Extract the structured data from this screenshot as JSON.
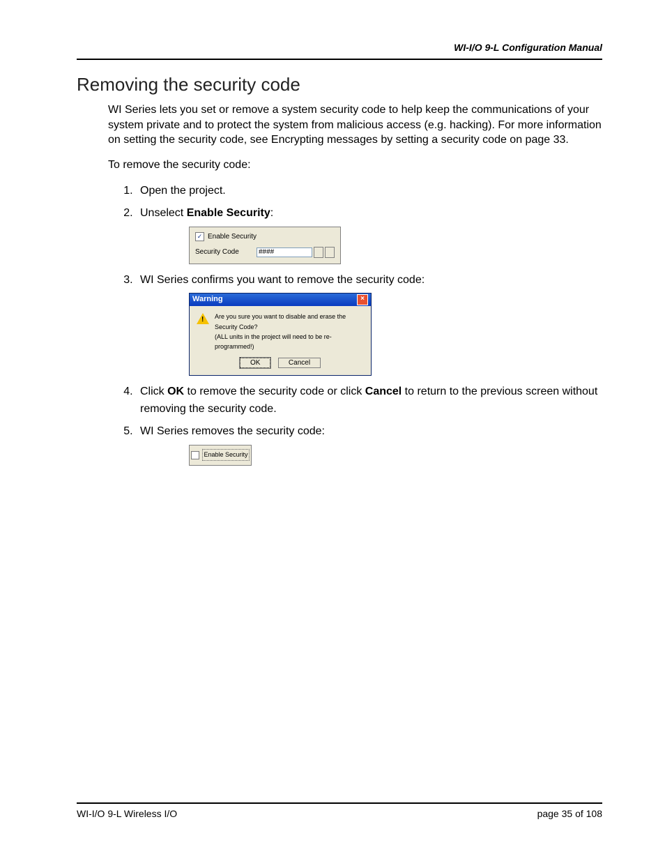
{
  "header": {
    "doc_title": "WI-I/O 9-L Configuration Manual"
  },
  "section": {
    "title": "Removing the security code",
    "intro": "WI Series lets you set or remove a system security code to help keep the communications of your system private and to protect the system from malicious access (e.g. hacking). For more information on setting the security code, see Encrypting messages by setting a security code on page 33.",
    "lead_in": "To remove the security code:"
  },
  "steps": {
    "s1": "Open the project.",
    "s2_pre": "Unselect ",
    "s2_bold": "Enable Security",
    "s2_post": ":",
    "s3": "WI Series confirms you want to remove the security code:",
    "s4_pre": "Click ",
    "s4_b1": "OK",
    "s4_mid": " to remove the security code or click ",
    "s4_b2": "Cancel",
    "s4_post": " to return to the previous screen without removing the security code.",
    "s5": "WI Series removes the security code:"
  },
  "fig1": {
    "enable_label": "Enable Security",
    "code_label": "Security Code",
    "code_value": "####"
  },
  "fig2": {
    "title": "Warning",
    "line1": "Are you sure you want to disable and erase the Security Code?",
    "line2": "(ALL units in the project will need to be re-programmed!)",
    "ok": "OK",
    "cancel": "Cancel"
  },
  "fig3": {
    "enable_label": "Enable Security"
  },
  "footer": {
    "left": "WI-I/O 9-L Wireless I/O",
    "right": "page 35 of 108"
  }
}
